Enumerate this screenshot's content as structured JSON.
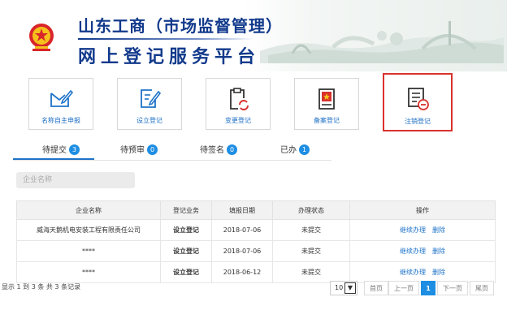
{
  "header": {
    "title_line1": "山东工商（市场监督管理）",
    "title_line2": "网上登记服务平台"
  },
  "tiles": [
    {
      "label": "名称自主申报",
      "icon": "name-declare-icon"
    },
    {
      "label": "设立登记",
      "icon": "establish-icon"
    },
    {
      "label": "变更登记",
      "icon": "change-icon"
    },
    {
      "label": "备案登记",
      "icon": "record-icon"
    },
    {
      "label": "注销登记",
      "icon": "cancel-icon"
    }
  ],
  "tabs": [
    {
      "label": "待提交",
      "count": "3"
    },
    {
      "label": "待预审",
      "count": "0"
    },
    {
      "label": "待签名",
      "count": "0"
    },
    {
      "label": "已办",
      "count": "1"
    }
  ],
  "search": {
    "placeholder": "企业名称"
  },
  "table": {
    "headers": [
      "企业名称",
      "登记业务",
      "填报日期",
      "办理状态",
      "操作"
    ],
    "rows": [
      {
        "name": "威海天鹅机电安装工程有限责任公司",
        "business": "设立登记",
        "date": "2018-07-06",
        "status": "未提交",
        "op1": "继续办理",
        "op2": "删除"
      },
      {
        "name": "****",
        "business": "设立登记",
        "date": "2018-07-06",
        "status": "未提交",
        "op1": "继续办理",
        "op2": "删除"
      },
      {
        "name": "****",
        "business": "设立登记",
        "date": "2018-06-12",
        "status": "未提交",
        "op1": "继续办理",
        "op2": "删除"
      }
    ]
  },
  "footer": {
    "summary": "显示 1 到 3 条 共 3 条记录",
    "page_size": "10",
    "first": "首页",
    "prev": "上一页",
    "current": "1",
    "next": "下一页",
    "last": "尾页"
  },
  "colors": {
    "accent": "#1e8ee3",
    "title": "#123a8c",
    "highlight_border": "#d9322e"
  }
}
